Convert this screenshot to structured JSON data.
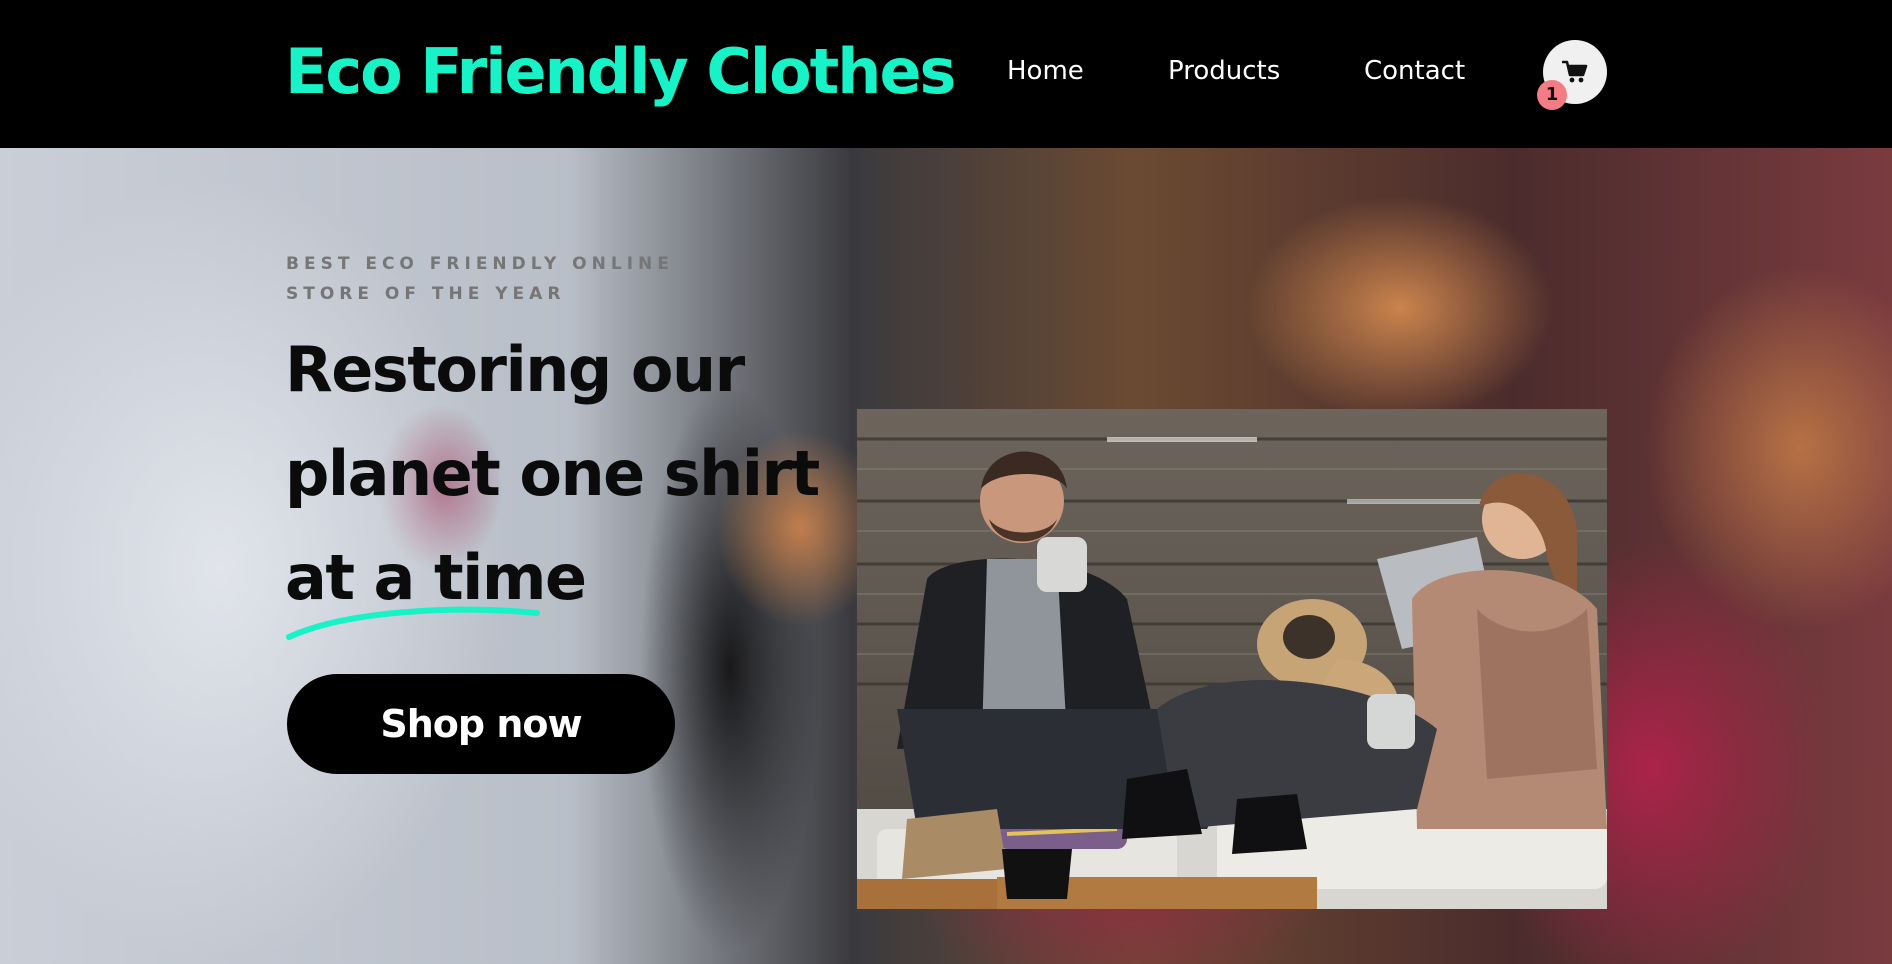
{
  "header": {
    "brand": "Eco Friendly Clothes",
    "nav": [
      {
        "label": "Home"
      },
      {
        "label": "Products"
      },
      {
        "label": "Contact"
      }
    ],
    "cart": {
      "icon": "cart-icon",
      "count": "1",
      "badge_color": "#f47c84"
    }
  },
  "hero": {
    "tagline": "BEST ECO FRIENDLY ONLINE STORE OF THE YEAR",
    "heading": "Restoring our planet one shirt at a time",
    "cta_label": "Shop now",
    "photo": {
      "icon": "photo-couple-with-pug"
    }
  },
  "colors": {
    "accent": "#18f2c7",
    "header_bg": "#000000",
    "button_bg": "#000000",
    "badge": "#f47c84"
  }
}
